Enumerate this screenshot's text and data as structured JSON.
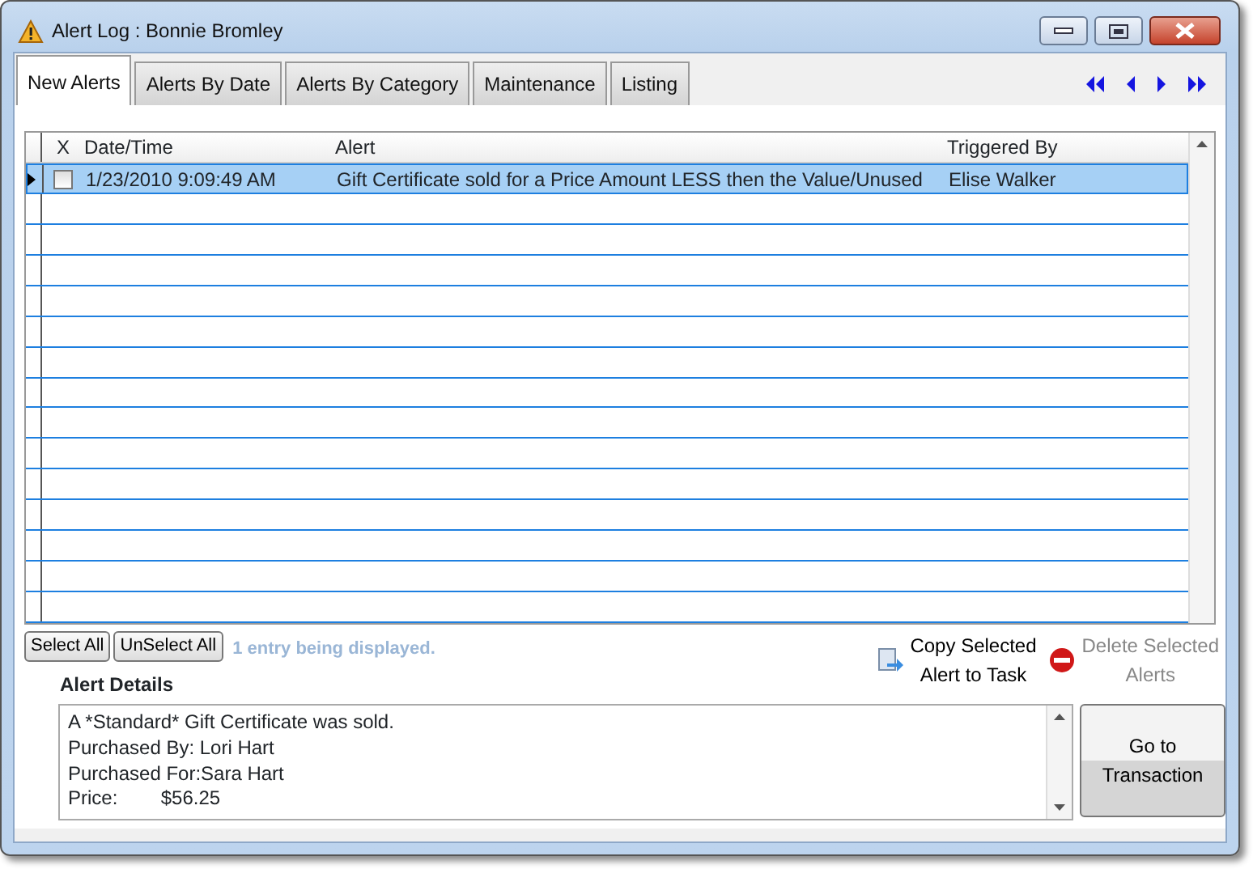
{
  "window": {
    "title": "Alert Log : Bonnie Bromley"
  },
  "tabs": [
    {
      "label": "New Alerts",
      "selected": true
    },
    {
      "label": "Alerts By Date",
      "selected": false
    },
    {
      "label": "Alerts By Category",
      "selected": false
    },
    {
      "label": "Maintenance",
      "selected": false
    },
    {
      "label": "Listing",
      "selected": false
    }
  ],
  "table": {
    "checkbox_header": "X",
    "columns": [
      "Date/Time",
      "Alert",
      "Triggered By"
    ],
    "rows": [
      {
        "selected": true,
        "checked": false,
        "cells": [
          "1/23/2010 9:09:49 AM",
          "Gift Certificate sold for a Price Amount LESS then the Value/Unused",
          "Elise Walker"
        ]
      }
    ]
  },
  "selection_buttons": [
    "Select All",
    "UnSelect All"
  ],
  "status": "1 entry being displayed.",
  "actions": [
    {
      "kind": "copy",
      "label": [
        "Copy Selected",
        "Alert to Task"
      ],
      "disabled": false
    },
    {
      "kind": "delete",
      "label": [
        "Delete Selected",
        "Alerts"
      ],
      "disabled": true
    }
  ],
  "details": {
    "title": "Alert Details",
    "lines": [
      "A *Standard* Gift Certificate was sold.",
      "Purchased By: Lori Hart",
      "Purchased For:Sara Hart",
      "Price:        $56.25"
    ]
  },
  "go_button": [
    "Go to",
    "Transaction"
  ]
}
